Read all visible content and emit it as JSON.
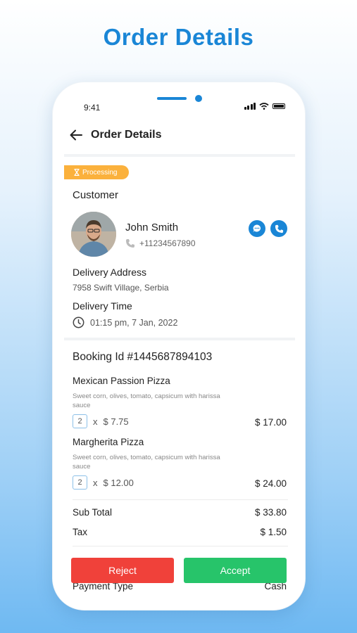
{
  "page": {
    "heading": "Order Details"
  },
  "status_bar": {
    "time": "9:41"
  },
  "header": {
    "title": "Order Details"
  },
  "status_badge": {
    "label": "Processing"
  },
  "customer": {
    "section_title": "Customer",
    "name": "John Smith",
    "phone": "+11234567890"
  },
  "delivery": {
    "address_label": "Delivery Address",
    "address": "7958 Swift Village, Serbia",
    "time_label": "Delivery Time",
    "time": "01:15 pm, 7 Jan, 2022"
  },
  "booking": {
    "title": "Booking Id #1445687894103"
  },
  "items": [
    {
      "name": "Mexican Passion Pizza",
      "description": "Sweet corn, olives, tomato, capsicum with harissa sauce",
      "quantity": "2",
      "times": "x",
      "unit_price": "$ 7.75",
      "total": "$ 17.00"
    },
    {
      "name": "Margherita Pizza",
      "description": "Sweet corn, olives, tomato, capsicum with harissa sauce",
      "quantity": "2",
      "times": "x",
      "unit_price": "$ 12.00",
      "total": "$ 24.00"
    }
  ],
  "summary": {
    "subtotal_label": "Sub Total",
    "subtotal": "$ 33.80",
    "tax_label": "Tax",
    "tax": "$ 1.50",
    "payment_type_label": "Payment Type",
    "payment_type": "Cash"
  },
  "actions": {
    "reject": "Reject",
    "accept": "Accept"
  },
  "colors": {
    "accent": "#1a86d6",
    "processing": "#fbb13c",
    "reject": "#f0413a",
    "accept": "#27c46a"
  },
  "icons": [
    "back-arrow-icon",
    "hourglass-icon",
    "chat-icon",
    "phone-icon",
    "clock-icon",
    "signal-icon",
    "wifi-icon",
    "battery-icon"
  ]
}
